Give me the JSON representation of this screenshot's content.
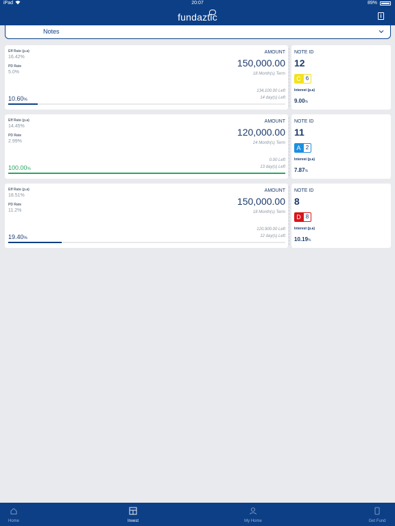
{
  "status_bar": {
    "carrier": "iPad",
    "time": "20:07",
    "battery": "89%"
  },
  "header": {
    "logo": "fundaztic"
  },
  "filter": {
    "selected": "Notes"
  },
  "labels": {
    "eff_rate": "Eff Rate (p.a)",
    "pd_rate": "PD Rate",
    "amount": "AMOUNT",
    "note_id": "NOTE ID",
    "interest": "Interest (p.a)",
    "pct_sign": "%"
  },
  "notes": [
    {
      "eff_rate": "16.42%",
      "pd_rate": "5.0%",
      "amount": "150,000.00",
      "term": "18 Month(s) Term",
      "amount_left": "134,100.00 Left",
      "days_left": "14 day(s) Left",
      "funded": "10.60",
      "funded_fraction": 0.106,
      "note_id": "12",
      "grade": "C",
      "grade_num": "6",
      "interest": "9.00",
      "grade_color": "#f4e21c",
      "grade_border": "#f4e21c"
    },
    {
      "eff_rate": "14.45%",
      "pd_rate": "2.99%",
      "amount": "120,000.00",
      "term": "24 Month(s) Term",
      "amount_left": "0.00 Left",
      "days_left": "13 day(s) Left",
      "funded": "100.00",
      "funded_fraction": 1.0,
      "note_id": "11",
      "grade": "A",
      "grade_num": "2",
      "interest": "7.87",
      "grade_color": "#1d8fe0",
      "grade_border": "#1d8fe0"
    },
    {
      "eff_rate": "18.51%",
      "pd_rate": "11.2%",
      "amount": "150,000.00",
      "term": "18 Month(s) Term",
      "amount_left": "120,900.00 Left",
      "days_left": "12 day(s) Left",
      "funded": "19.40",
      "funded_fraction": 0.194,
      "note_id": "8",
      "grade": "D",
      "grade_num": "8",
      "interest": "10.19",
      "grade_color": "#d9141b",
      "grade_border": "#d9141b"
    }
  ],
  "tabs": [
    {
      "label": "Home",
      "icon": "home-icon",
      "active": false
    },
    {
      "label": "Invest",
      "icon": "invest-icon",
      "active": true
    },
    {
      "label": "My Home",
      "icon": "person-icon",
      "active": false
    },
    {
      "label": "Get Fund",
      "icon": "phone-icon",
      "active": false
    }
  ],
  "colors": {
    "brand": "#0c3f86",
    "complete": "#28a55f",
    "background": "#e9eaed"
  }
}
